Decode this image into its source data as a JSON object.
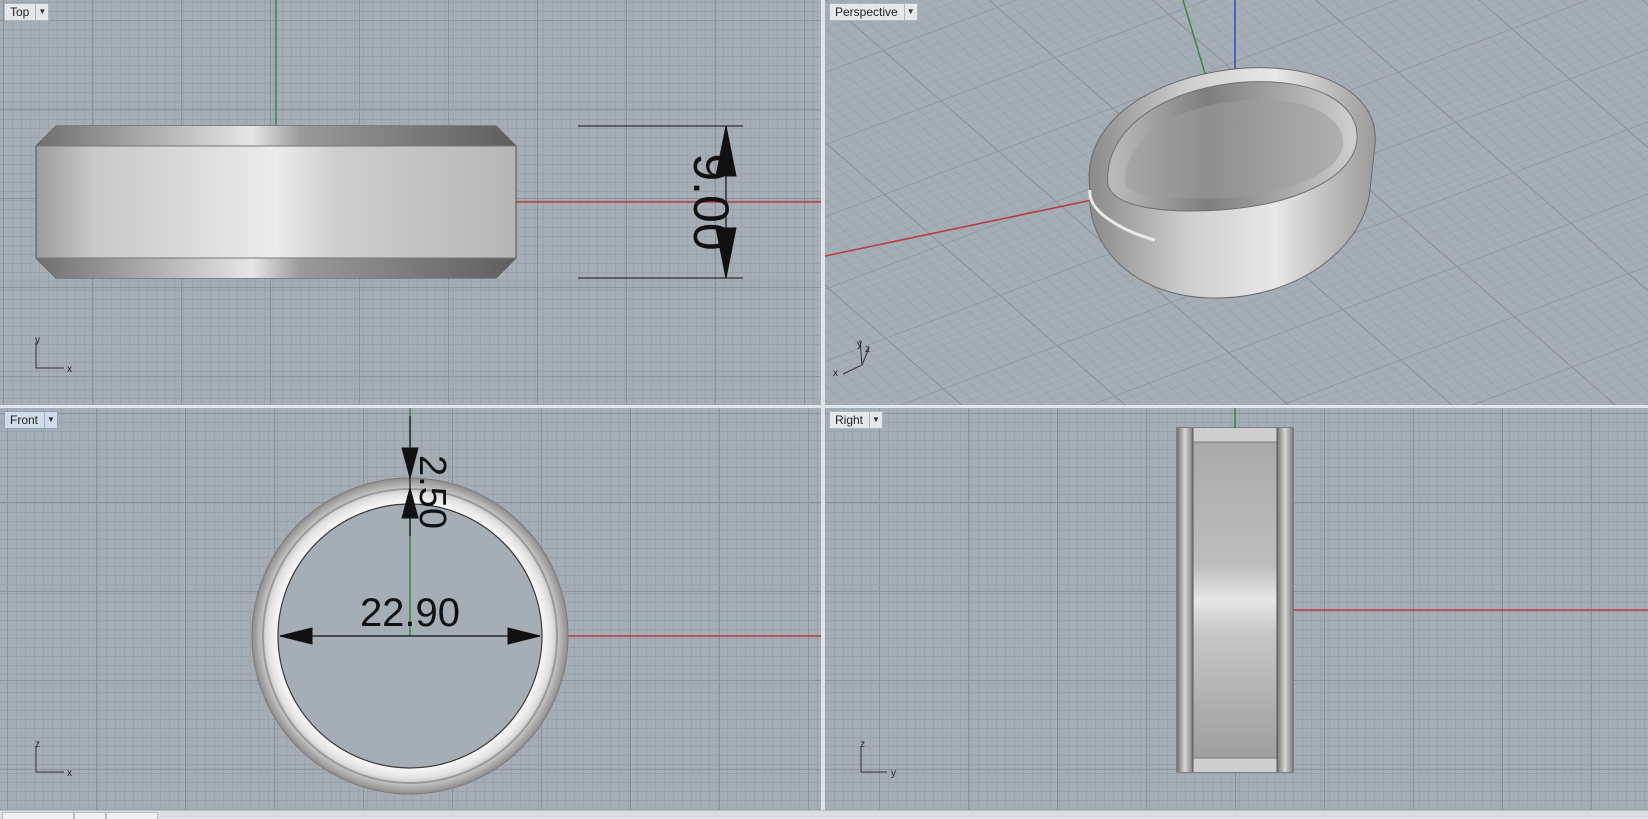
{
  "viewports": {
    "top": {
      "label": "Top",
      "axis_x": "x",
      "axis_y": "y",
      "dimension": "9.00"
    },
    "perspective": {
      "label": "Perspective",
      "axis_x": "x",
      "axis_y": "y",
      "axis_z": "z"
    },
    "front": {
      "label": "Front",
      "axis_x": "x",
      "axis_y": "z",
      "dimension_diameter": "22.90",
      "dimension_thickness": "2.50"
    },
    "right": {
      "label": "Right",
      "axis_x": "y",
      "axis_y": "z"
    }
  },
  "icons": {
    "dropdown": "triangle-down-icon",
    "axes": "axis-gizmo-icon"
  },
  "colors": {
    "x_axis": "#b83a3a",
    "y_axis": "#2f8f3a",
    "z_axis": "#3a48b8",
    "active_label": "#cfdbe9",
    "background": "#a5adb6"
  }
}
